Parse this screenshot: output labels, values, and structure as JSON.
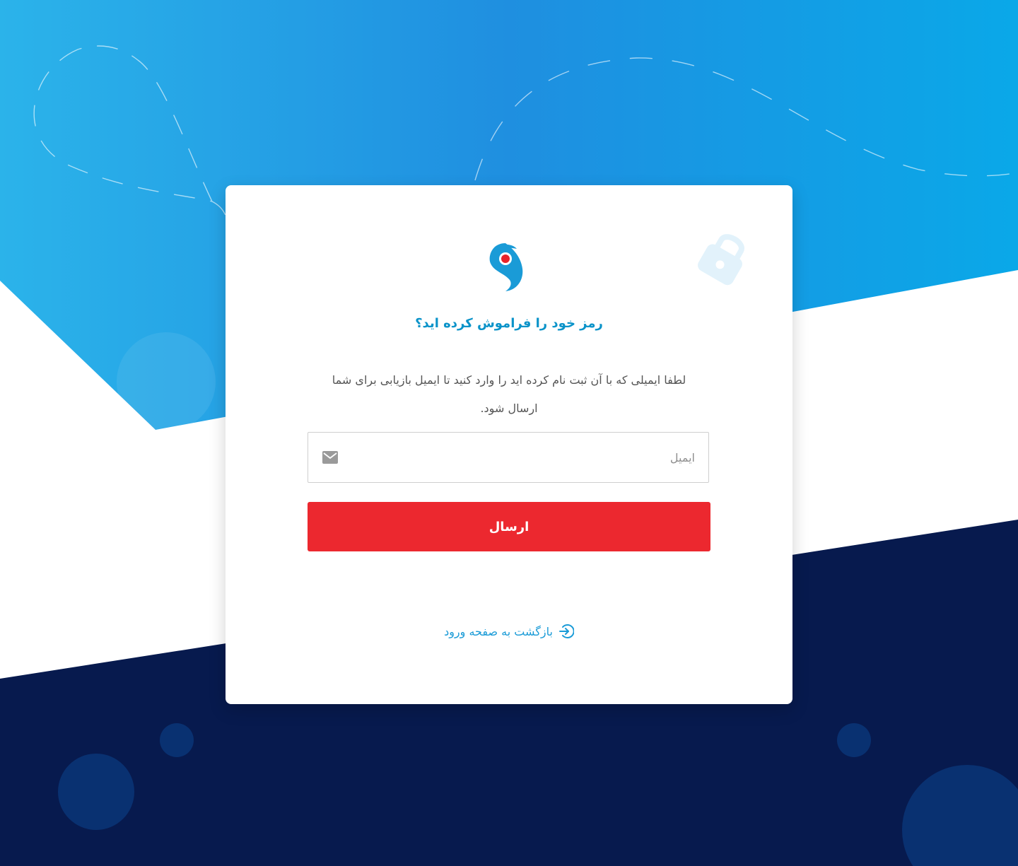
{
  "colors": {
    "brand_blue": "#1a9bd7",
    "title_blue": "#0a93c9",
    "submit_red": "#ec282f",
    "navy": "#071a4e",
    "gradient_start": "#2bb3ea",
    "gradient_mid": "#1f8fe0",
    "gradient_end": "#0aa8e8"
  },
  "card": {
    "title": "رمز خود را فراموش کرده اید؟",
    "description": "لطفا ایمیلی که با آن ثبت نام کرده اید را وارد کنید تا ایمیل بازیابی برای شما ارسال شود.",
    "email_field": {
      "placeholder": "ایمیل",
      "value": "",
      "icon": "mail-icon"
    },
    "submit_label": "ارسال",
    "back_link": {
      "label": "بازگشت به صفحه ورود",
      "icon": "login-icon"
    }
  },
  "icons": {
    "logo": "brand-logo",
    "lock": "lock-icon"
  }
}
